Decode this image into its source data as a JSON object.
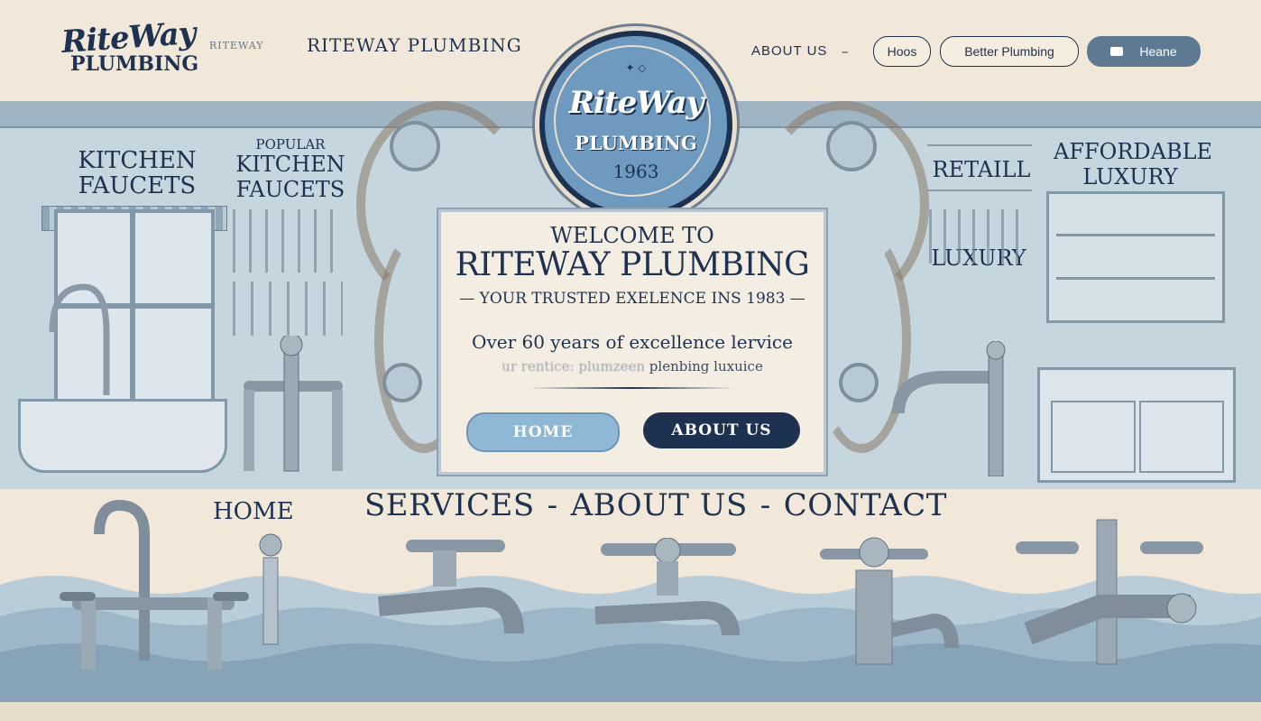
{
  "header": {
    "logo_top": "RiteWay",
    "logo_bottom": "PLUMBING",
    "small_brand": "RITEWAY",
    "title": "RITEWAY PLUMBING",
    "nav_about": "ABOUT US",
    "nav_dash": "–",
    "pill_hoos": "Hoos",
    "pill_better": "Better Plumbing",
    "pill_home": "Heane"
  },
  "room": {
    "kitchen_faucets": "KITCHEN FAUCETS",
    "popular_small": "POPULAR",
    "popular_kitchen_faucets": "KITCHEN FAUCETS",
    "retail": "RETAILL",
    "affordable_luxury": "AFFORDABLE LUXURY",
    "luxury": "LUXURY"
  },
  "emblem": {
    "top": "RiteWay",
    "middle": "PLUMBING",
    "year": "1963"
  },
  "card": {
    "welcome": "WELCOME TO",
    "brand": "RITEWAY PLUMBING",
    "trusted": "— YOUR TRUSTED EXELENCE INS 1983 —",
    "over": "Over 60 years of excellence lervice",
    "blur_left": "ur rentice: plumzeen",
    "blur_right": "plenbing luxuice",
    "btn_home": "HOME",
    "btn_about": "ABOUT US"
  },
  "lower_nav": {
    "home": "HOME",
    "services": "SERVICES",
    "about": "ABOUT US",
    "contact": "CONTACT",
    "separator": "-"
  },
  "colors": {
    "navy": "#1d3150",
    "light_blue": "#8fb7d6",
    "cream": "#f1e8da",
    "wall": "#c6d6df",
    "wave": "#a9c0cf"
  }
}
